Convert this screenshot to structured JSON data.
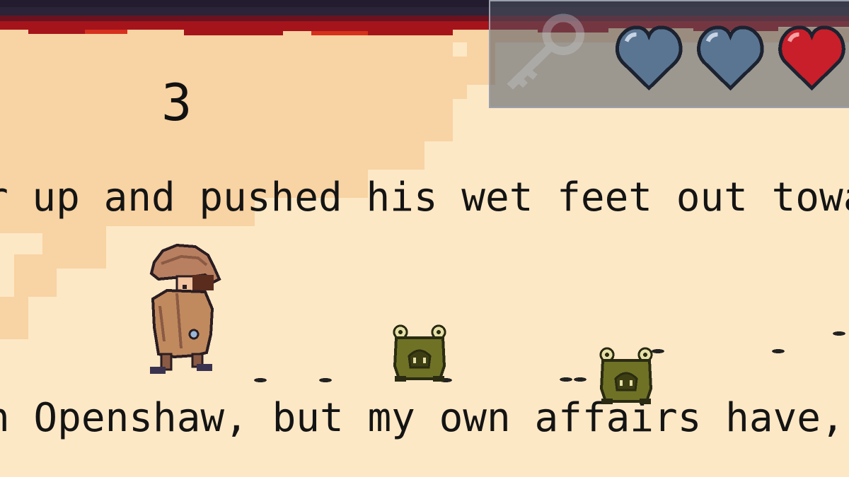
{
  "page": {
    "number": "3"
  },
  "story": {
    "lines": [
      "r up and pushed his wet feet out towards",
      "n Openshaw, but my own affairs have, as f",
      ""
    ]
  },
  "hud": {
    "key_icon": "key-icon",
    "hearts": [
      {
        "icon": "heart-icon",
        "state": "empty",
        "color": "#5a7592"
      },
      {
        "icon": "heart-icon",
        "state": "empty",
        "color": "#5a7592"
      },
      {
        "icon": "heart-icon",
        "state": "full",
        "color": "#c81f2a"
      }
    ]
  },
  "characters": {
    "player": {
      "icon": "detective-icon"
    },
    "enemies": [
      {
        "icon": "frog-monster-icon"
      },
      {
        "icon": "frog-monster-icon"
      }
    ]
  },
  "colors": {
    "paper": "#fde5c0",
    "paper_dark": "#f6cf9c",
    "top_border": "#2b2337",
    "blood": "#b3141a",
    "text": "#141414"
  }
}
